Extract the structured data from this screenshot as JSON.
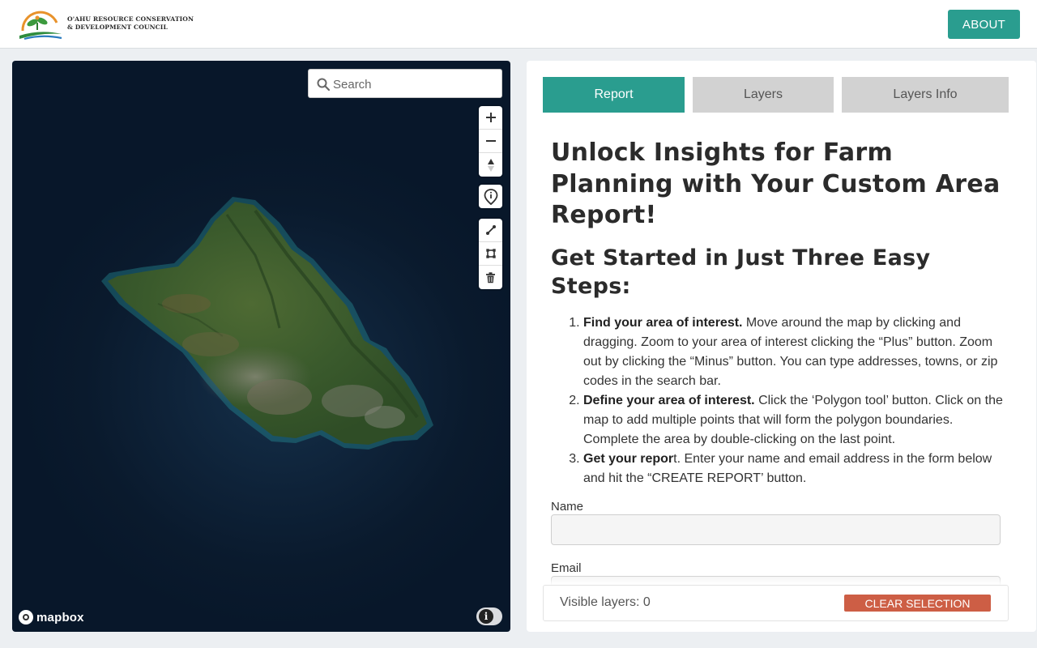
{
  "header": {
    "logo_line1": "O'AHU RESOURCE CONSERVATION",
    "logo_line2": "& DEVELOPMENT COUNCIL",
    "about_label": "ABOUT"
  },
  "map": {
    "search_placeholder": "Search",
    "controls": [
      "plus-icon",
      "minus-icon",
      "compass-icon",
      "info-pin-icon",
      "line-tool-icon",
      "polygon-tool-icon",
      "trash-icon"
    ],
    "attribution_logo": "mapbox"
  },
  "tabs": [
    {
      "label": "Report",
      "active": true
    },
    {
      "label": "Layers",
      "active": false
    },
    {
      "label": "Layers Info",
      "active": false
    }
  ],
  "report": {
    "title": "Unlock Insights for Farm Planning with Your Custom Area Report!",
    "subtitle": "Get Started in Just Three Easy Steps:",
    "steps": [
      {
        "bold": "Find your area of interest.",
        "text": " Move around the map by clicking and dragging. Zoom to your area of interest clicking the “Plus” button. Zoom out by clicking the “Minus” button. You can type addresses, towns, or zip codes in the search bar."
      },
      {
        "bold": "Define your area of interest.",
        "text": " Click the ‘Polygon tool’ button. Click on the map to add multiple points that will form the polygon boundaries. Complete the area by double-clicking on the last point."
      },
      {
        "bold": "Get your repor",
        "text": "t. Enter your name and email address in the form below and hit the “CREATE REPORT’ button."
      }
    ],
    "name_label": "Name",
    "name_value": "",
    "email_label": "Email",
    "email_value": ""
  },
  "footer": {
    "visible_layers": "Visible layers: 0",
    "clear_label": "CLEAR SELECTION"
  },
  "colors": {
    "accent": "#2a9d8f",
    "danger": "#cd5e45",
    "tab_inactive": "#d2d2d2"
  }
}
